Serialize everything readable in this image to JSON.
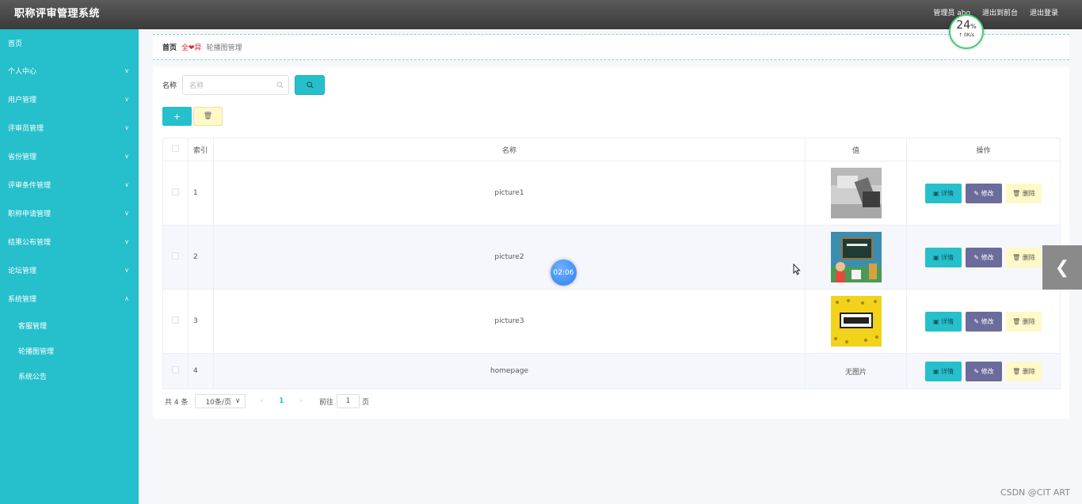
{
  "header": {
    "title": "职称评审管理系统",
    "links": [
      "管理员 abo",
      "退出到前台",
      "退出登录"
    ]
  },
  "sidebar": {
    "items": [
      {
        "label": "首页",
        "has_chevron": false
      },
      {
        "label": "个人中心",
        "has_chevron": true
      },
      {
        "label": "用户管理",
        "has_chevron": true
      },
      {
        "label": "评审员管理",
        "has_chevron": true
      },
      {
        "label": "省份管理",
        "has_chevron": true
      },
      {
        "label": "评审条件管理",
        "has_chevron": true
      },
      {
        "label": "职称申请管理",
        "has_chevron": true
      },
      {
        "label": "结果公布管理",
        "has_chevron": true
      },
      {
        "label": "论坛管理",
        "has_chevron": true
      },
      {
        "label": "系统管理",
        "has_chevron": true,
        "expanded": true
      }
    ],
    "sub_items": [
      "客服管理",
      "轮播图管理",
      "系统公告"
    ]
  },
  "breadcrumb": {
    "home": "首页",
    "separator": "全❤异",
    "current": "轮播图管理"
  },
  "search": {
    "label": "名称",
    "placeholder": "名称"
  },
  "table": {
    "columns": [
      "索引",
      "名称",
      "值",
      "操作"
    ],
    "rows": [
      {
        "index": "1",
        "name": "picture1",
        "value_image": "office-photo"
      },
      {
        "index": "2",
        "name": "picture2",
        "value_image": "classroom-illustration"
      },
      {
        "index": "3",
        "name": "picture3",
        "value_image": "yellow-title-banner"
      },
      {
        "index": "4",
        "name": "homepage",
        "value_text": "无图片"
      }
    ],
    "actions": {
      "detail": "详情",
      "edit": "修改",
      "delete": "删除"
    }
  },
  "pagination": {
    "total": "共 4 条",
    "page_size": "10条/页",
    "current_page": "1",
    "goto_label": "前往",
    "goto_value": "1",
    "page_suffix": "页"
  },
  "overlays": {
    "speed_percent": "24",
    "speed_unit": "%",
    "speed_rate": "0K/s",
    "timer": "02:06"
  },
  "watermark": "CSDN @CIT ART",
  "colors": {
    "accent": "#26bfcc",
    "edit_button": "#6b6b9c",
    "delete_button": "#fff8c7",
    "header": "#3a3a3a"
  }
}
